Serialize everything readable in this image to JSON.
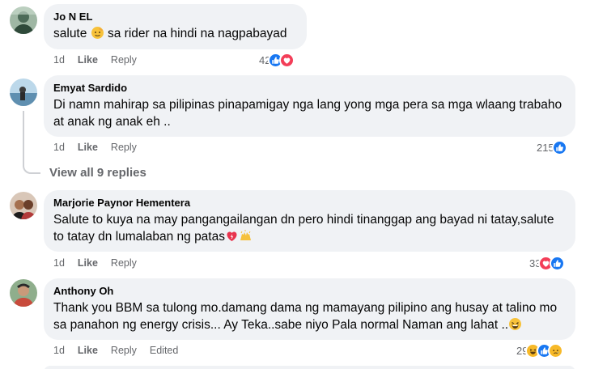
{
  "comments": [
    {
      "author": "Jo N EL",
      "text_before_emoji": "salute ",
      "text_after_emoji": " sa rider na hindi na nagpabayad",
      "time": "1d",
      "like_label": "Like",
      "reply_label": "Reply",
      "reaction_count": "42",
      "reactions": [
        "like-icon",
        "love-icon"
      ]
    },
    {
      "author": "Emyat Sardido",
      "text": "Di namn mahirap sa pilipinas pinapamigay nga lang yong mga pera sa mga wlaang trabaho at anak ng anak eh ..",
      "time": "1d",
      "like_label": "Like",
      "reply_label": "Reply",
      "reaction_count": "215",
      "reactions": [
        "like-icon"
      ],
      "view_replies_label": "View all 9 replies"
    },
    {
      "author": "Marjorie Paynor Hementera",
      "text": "Salute to kuya na may pangangailangan dn pero hindi tinanggap ang bayad ni tatay,salute to tatay dn lumalaban ng patas",
      "time": "1d",
      "like_label": "Like",
      "reply_label": "Reply",
      "reaction_count": "33",
      "reactions": [
        "love-icon",
        "like-icon"
      ]
    },
    {
      "author": "Anthony Oh",
      "text": "Thank you BBM sa tulong mo.damang dama ng mamayang pilipino ang husay at talino mo sa panahon ng energy crisis... Ay Teka..sabe niyo Pala normal Naman ang lahat ..",
      "time": "1d",
      "like_label": "Like",
      "reply_label": "Reply",
      "edited_label": "Edited",
      "reaction_count": "29",
      "reactions": [
        "haha-icon",
        "like-icon",
        "sad-icon"
      ]
    }
  ],
  "colors": {
    "bubble": "#f0f2f5",
    "meta": "#65676b",
    "like": "#1877f2",
    "love": "#f33e58",
    "haha": "#f7b928"
  }
}
